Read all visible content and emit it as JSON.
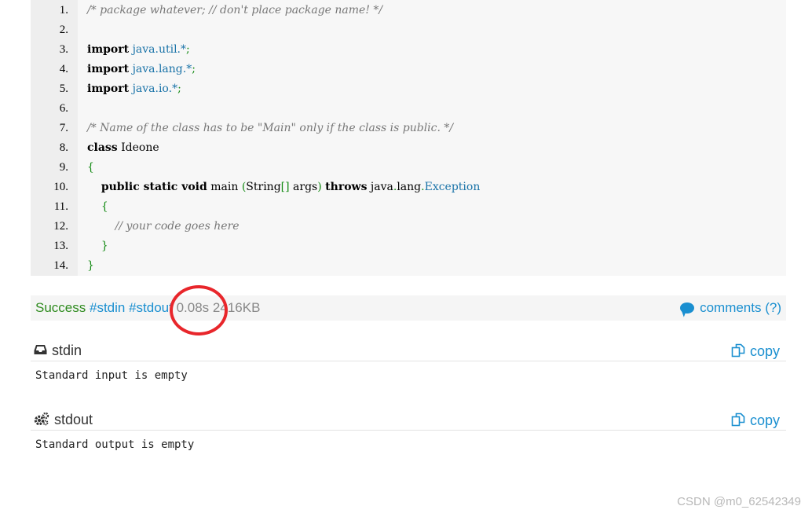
{
  "code": {
    "lines": [
      {
        "n": "1.",
        "tokens": [
          {
            "c": "com",
            "t": "/* package whatever; // don't place package name! */"
          }
        ]
      },
      {
        "n": "2.",
        "tokens": []
      },
      {
        "n": "3.",
        "tokens": [
          {
            "c": "kw",
            "t": "import"
          },
          {
            "c": "id",
            "t": " "
          },
          {
            "c": "pk",
            "t": "java.util.*"
          },
          {
            "c": "pn",
            "t": ";"
          }
        ]
      },
      {
        "n": "4.",
        "tokens": [
          {
            "c": "kw",
            "t": "import"
          },
          {
            "c": "id",
            "t": " "
          },
          {
            "c": "pk",
            "t": "java.lang.*"
          },
          {
            "c": "pn",
            "t": ";"
          }
        ]
      },
      {
        "n": "5.",
        "tokens": [
          {
            "c": "kw",
            "t": "import"
          },
          {
            "c": "id",
            "t": " "
          },
          {
            "c": "pk",
            "t": "java.io.*"
          },
          {
            "c": "pn",
            "t": ";"
          }
        ]
      },
      {
        "n": "6.",
        "tokens": []
      },
      {
        "n": "7.",
        "tokens": [
          {
            "c": "com",
            "t": "/* Name of the class has to be \"Main\" only if the class is public. */"
          }
        ]
      },
      {
        "n": "8.",
        "tokens": [
          {
            "c": "kw",
            "t": "class"
          },
          {
            "c": "id",
            "t": " Ideone"
          }
        ]
      },
      {
        "n": "9.",
        "tokens": [
          {
            "c": "pn",
            "t": "{"
          }
        ]
      },
      {
        "n": "10.",
        "tokens": [
          {
            "c": "id",
            "t": "    "
          },
          {
            "c": "kw",
            "t": "public static void"
          },
          {
            "c": "id",
            "t": " main "
          },
          {
            "c": "pn",
            "t": "("
          },
          {
            "c": "id",
            "t": "String"
          },
          {
            "c": "pn",
            "t": "[]"
          },
          {
            "c": "id",
            "t": " args"
          },
          {
            "c": "pn",
            "t": ")"
          },
          {
            "c": "id",
            "t": " "
          },
          {
            "c": "kw",
            "t": "throws"
          },
          {
            "c": "id",
            "t": " java"
          },
          {
            "c": "pn",
            "t": "."
          },
          {
            "c": "id",
            "t": "lang"
          },
          {
            "c": "pn",
            "t": "."
          },
          {
            "c": "pk",
            "t": "Exception"
          }
        ]
      },
      {
        "n": "11.",
        "tokens": [
          {
            "c": "id",
            "t": "    "
          },
          {
            "c": "pn",
            "t": "{"
          }
        ]
      },
      {
        "n": "12.",
        "tokens": [
          {
            "c": "id",
            "t": "        "
          },
          {
            "c": "com",
            "t": "// your code goes here"
          }
        ]
      },
      {
        "n": "13.",
        "tokens": [
          {
            "c": "id",
            "t": "    "
          },
          {
            "c": "pn",
            "t": "}"
          }
        ]
      },
      {
        "n": "14.",
        "tokens": [
          {
            "c": "pn",
            "t": "}"
          }
        ]
      }
    ]
  },
  "status": {
    "result": "Success",
    "stdin_tag": "#stdin",
    "stdout_tag": "#stdout",
    "time": "0.08s",
    "memory": "2416KB",
    "comments": "comments (?)"
  },
  "stdin": {
    "title": "stdin",
    "copy": "copy",
    "content": "Standard input is empty"
  },
  "stdout": {
    "title": "stdout",
    "copy": "copy",
    "content": "Standard output is empty"
  },
  "watermark": "CSDN @m0_62542349",
  "colors": {
    "success": "#2e8b1e",
    "link": "#1a8fd0",
    "highlight_circle": "#e8262b"
  },
  "icons": {
    "comments": "comment-bubble-icon",
    "stdin": "inbox-icon",
    "stdout": "gears-icon",
    "copy": "copy-icon"
  }
}
